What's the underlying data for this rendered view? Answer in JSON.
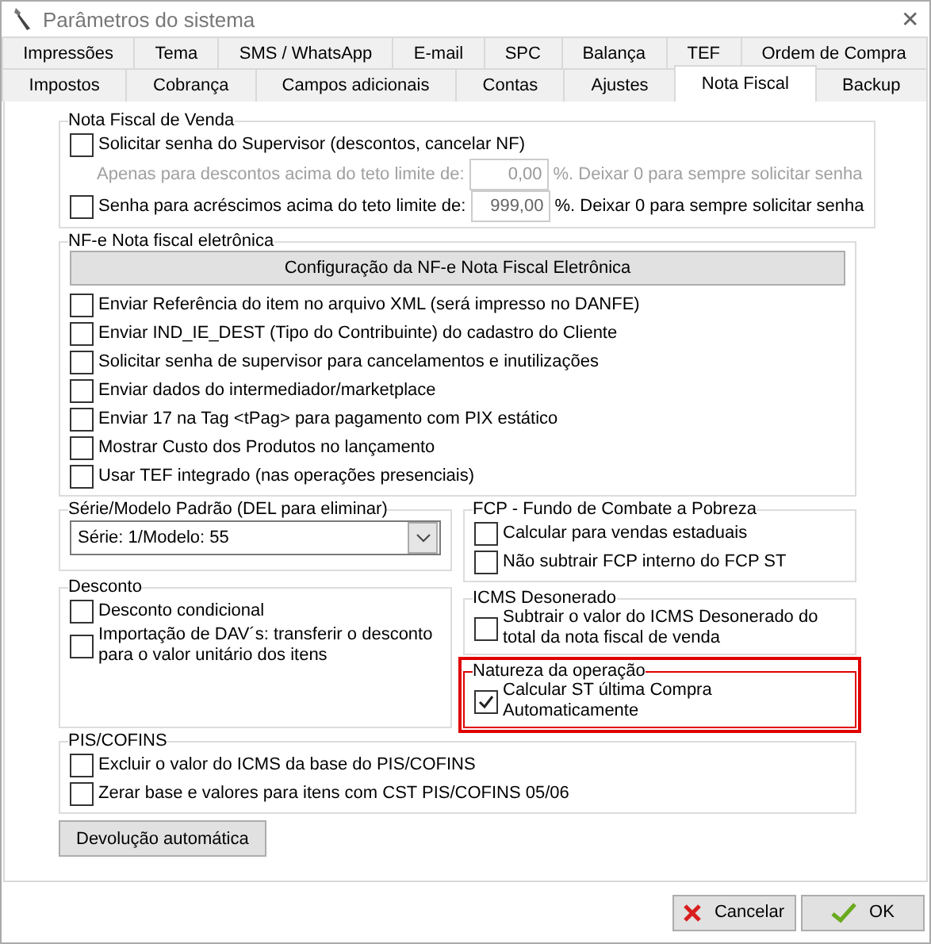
{
  "window": {
    "title": "Parâmetros do sistema",
    "close": "✕"
  },
  "tab_rows": [
    [
      {
        "label": "Impressões",
        "selected": false
      },
      {
        "label": "Tema",
        "selected": false
      },
      {
        "label": "SMS / WhatsApp",
        "selected": false
      },
      {
        "label": "E-mail",
        "selected": false
      },
      {
        "label": "SPC",
        "selected": false
      },
      {
        "label": "Balança",
        "selected": false
      },
      {
        "label": "TEF",
        "selected": false
      },
      {
        "label": "Ordem de Compra",
        "selected": false
      }
    ],
    [
      {
        "label": "Impostos",
        "selected": false
      },
      {
        "label": "Cobrança",
        "selected": false
      },
      {
        "label": "Campos adicionais",
        "selected": false
      },
      {
        "label": "Contas",
        "selected": false
      },
      {
        "label": "Ajustes",
        "selected": false
      },
      {
        "label": "Nota Fiscal",
        "selected": true
      },
      {
        "label": "Backup",
        "selected": false
      }
    ]
  ],
  "top_groups": [
    {
      "title": "Nota Fiscal de Venda",
      "highlighted": false,
      "items": [
        {
          "kind": "checkbox",
          "label": "Solicitar senha do Supervisor (descontos, cancelar NF)",
          "checked": false
        },
        {
          "kind": "limit",
          "disabled": true,
          "label": "Apenas para descontos acima do teto limite de:",
          "value": "0,00",
          "suffix": "%. Deixar 0 para sempre solicitar senha"
        },
        {
          "kind": "checkbox_limit",
          "disabled": false,
          "checked": false,
          "label": "Senha para acréscimos acima do teto limite de:",
          "value": "999,00",
          "suffix": "%. Deixar 0 para sempre solicitar senha"
        }
      ]
    },
    {
      "title": "NF-e Nota fiscal eletrônica",
      "highlighted": false,
      "items": [
        {
          "kind": "button",
          "label": "Configuração da NF-e Nota Fiscal Eletrônica"
        },
        {
          "kind": "checkbox",
          "label": "Enviar Referência do item no arquivo XML (será impresso no DANFE)",
          "checked": false
        },
        {
          "kind": "checkbox",
          "label": "Enviar IND_IE_DEST (Tipo do Contribuinte) do cadastro do Cliente",
          "checked": false
        },
        {
          "kind": "checkbox",
          "label": "Solicitar senha de supervisor para cancelamentos e inutilizações",
          "checked": false
        },
        {
          "kind": "checkbox",
          "label": "Enviar dados do intermediador/marketplace",
          "checked": false
        },
        {
          "kind": "checkbox",
          "label": "Enviar 17 na Tag <tPag> para pagamento com PIX estático",
          "checked": false
        },
        {
          "kind": "checkbox",
          "label": "Mostrar Custo dos Produtos no lançamento",
          "checked": false
        },
        {
          "kind": "checkbox",
          "label": "Usar TEF integrado (nas operações presenciais)",
          "checked": false
        }
      ]
    }
  ],
  "left_groups": [
    {
      "title": "Série/Modelo Padrão (DEL para eliminar)",
      "highlighted": false,
      "items": [
        {
          "kind": "select",
          "value": "Série: 1/Modelo: 55"
        }
      ]
    },
    {
      "title": "Desconto",
      "highlighted": false,
      "items": [
        {
          "kind": "checkbox",
          "label": "Desconto condicional",
          "checked": false
        },
        {
          "kind": "checkbox",
          "label": "Importação de DAV´s: transferir o desconto para o valor unitário dos itens",
          "checked": false
        }
      ]
    }
  ],
  "right_groups": [
    {
      "title": "FCP - Fundo de Combate a Pobreza",
      "highlighted": false,
      "items": [
        {
          "kind": "checkbox",
          "label": "Calcular para vendas estaduais",
          "checked": false
        },
        {
          "kind": "checkbox",
          "label": "Não subtrair FCP interno do FCP ST",
          "checked": false
        }
      ]
    },
    {
      "title": "ICMS Desonerado",
      "highlighted": false,
      "items": [
        {
          "kind": "checkbox",
          "label": "Subtrair o valor do ICMS Desonerado do total da nota fiscal de venda",
          "checked": false
        }
      ]
    },
    {
      "title": "Natureza da operação",
      "highlighted": true,
      "items": [
        {
          "kind": "checkbox",
          "label": "Calcular ST última Compra Automaticamente",
          "checked": true
        }
      ]
    }
  ],
  "bottom_groups": [
    {
      "title": "PIS/COFINS",
      "highlighted": false,
      "items": [
        {
          "kind": "checkbox",
          "label": "Excluir o valor do ICMS da base do PIS/COFINS",
          "checked": false
        },
        {
          "kind": "checkbox",
          "label": "Zerar base e valores para itens com CST PIS/COFINS 05/06",
          "checked": false
        }
      ]
    }
  ],
  "devolucao_button": "Devolução automática",
  "buttons": [
    {
      "kind": "cancel",
      "label": "Cancelar"
    },
    {
      "kind": "ok",
      "label": "OK"
    }
  ]
}
